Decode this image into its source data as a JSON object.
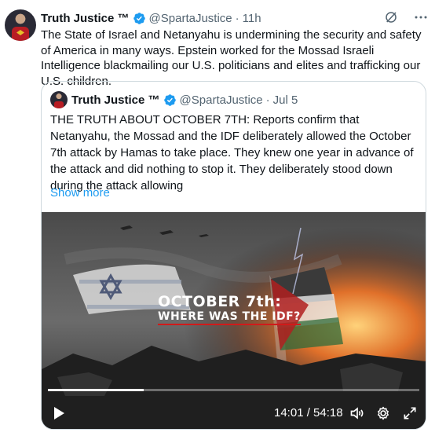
{
  "tweet": {
    "author_name": "Truth Justice ™",
    "handle": "@SpartaJustice",
    "separator": "·",
    "time": "11h",
    "text": "The State of Israel and Netanyahu is undermining the security and safety of America in many ways. Epstein worked for the Mossad Israeli Intelligence blackmailing our U.S. politicians and elites and trafficking our U.S. children."
  },
  "quoted": {
    "author_name": "Truth Justice ™",
    "handle": "@SpartaJustice",
    "separator": "·",
    "time": "Jul 5",
    "text": "THE TRUTH ABOUT OCTOBER 7TH: Reports confirm that Netanyahu, the Mossad and the IDF deliberately allowed the October 7th attack by Hamas to take place. They knew one year in advance of the attack and did nothing to stop it. They deliberately stood down during the attack allowing",
    "show_more": "Show more",
    "video": {
      "title_line1": "OCTOBER 7th:",
      "title_line2": "WHERE WAS THE IDF?",
      "current_time": "14:01",
      "duration": "54:18",
      "time_display": "14:01 / 54:18",
      "progress_fraction": 0.258
    }
  },
  "icons": {
    "verified": "verified-badge-icon",
    "grok": "grok-icon",
    "more": "more-options-icon",
    "play": "play-icon",
    "volume": "volume-icon",
    "settings": "settings-gear-icon",
    "fullscreen": "fullscreen-icon"
  },
  "colors": {
    "accent": "#1d9bf0",
    "muted_text": "#536471",
    "border": "#cfd9de"
  }
}
